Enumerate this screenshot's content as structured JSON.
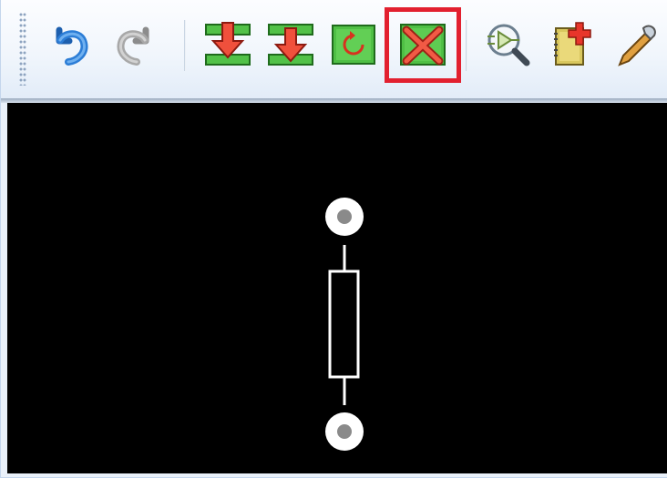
{
  "window": {
    "background": "#eaf1fa"
  },
  "toolbar": {
    "buttons": [
      {
        "name": "undo-button",
        "icon": "undo-arrow-icon",
        "enabled": true
      },
      {
        "name": "redo-button",
        "icon": "redo-arrow-icon",
        "enabled": false
      },
      {
        "name": "import-button",
        "icon": "green-import-arrow-icon",
        "enabled": true
      },
      {
        "name": "import-alt-button",
        "icon": "green-import-arrow-alt-icon",
        "enabled": true
      },
      {
        "name": "refresh-button",
        "icon": "green-refresh-icon",
        "enabled": true
      },
      {
        "name": "close-x-button",
        "icon": "green-red-x-icon",
        "enabled": true,
        "highlighted": true
      },
      {
        "name": "inspect-button",
        "icon": "magnifier-component-icon",
        "enabled": true
      },
      {
        "name": "add-component-button",
        "icon": "notebook-plus-icon",
        "enabled": true
      },
      {
        "name": "tool-button",
        "icon": "pen-tool-icon",
        "enabled": true
      }
    ],
    "highlight_color": "#e2202f"
  },
  "canvas": {
    "background": "#000000",
    "component": {
      "type": "resistor",
      "pads": 2,
      "pad_color": "#ffffff",
      "pad_hole_color": "#8a8a8a",
      "outline_color": "#ffffff"
    }
  }
}
